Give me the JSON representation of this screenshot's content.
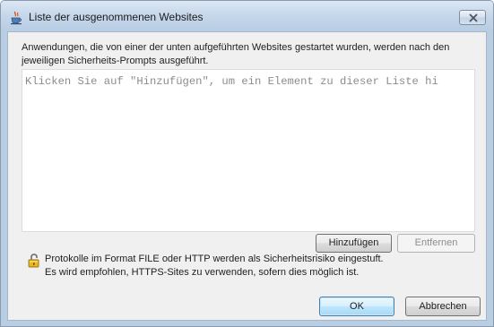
{
  "window": {
    "title": "Liste der ausgenommenen Websites"
  },
  "description": {
    "line1": "Anwendungen, die von einer der unten aufgeführten Websites gestartet wurden, werden nach den",
    "line2": "jeweiligen Sicherheits-Prompts ausgeführt."
  },
  "site_list": {
    "placeholder": "Klicken Sie auf \"Hinzufügen\", um ein Element zu dieser Liste hi",
    "items": []
  },
  "list_buttons": {
    "add_label": "Hinzufügen",
    "remove_label": "Entfernen"
  },
  "notice": {
    "line1": "Protokolle im Format FILE oder HTTP werden als Sicherheitsrisiko eingestuft.",
    "line2": "Es wird empfohlen, HTTPS-Sites zu verwenden, sofern dies möglich ist."
  },
  "dialog_buttons": {
    "ok_label": "OK",
    "cancel_label": "Abbrechen"
  },
  "icons": {
    "app": "java-coffee-cup-icon",
    "close": "close-icon",
    "notice": "padlock-icon"
  },
  "colors": {
    "titlebar": "#c3d5e9",
    "client_bg": "#f0f0f0",
    "default_button": "#bee6fd",
    "placeholder_text": "#8c8c8c"
  }
}
